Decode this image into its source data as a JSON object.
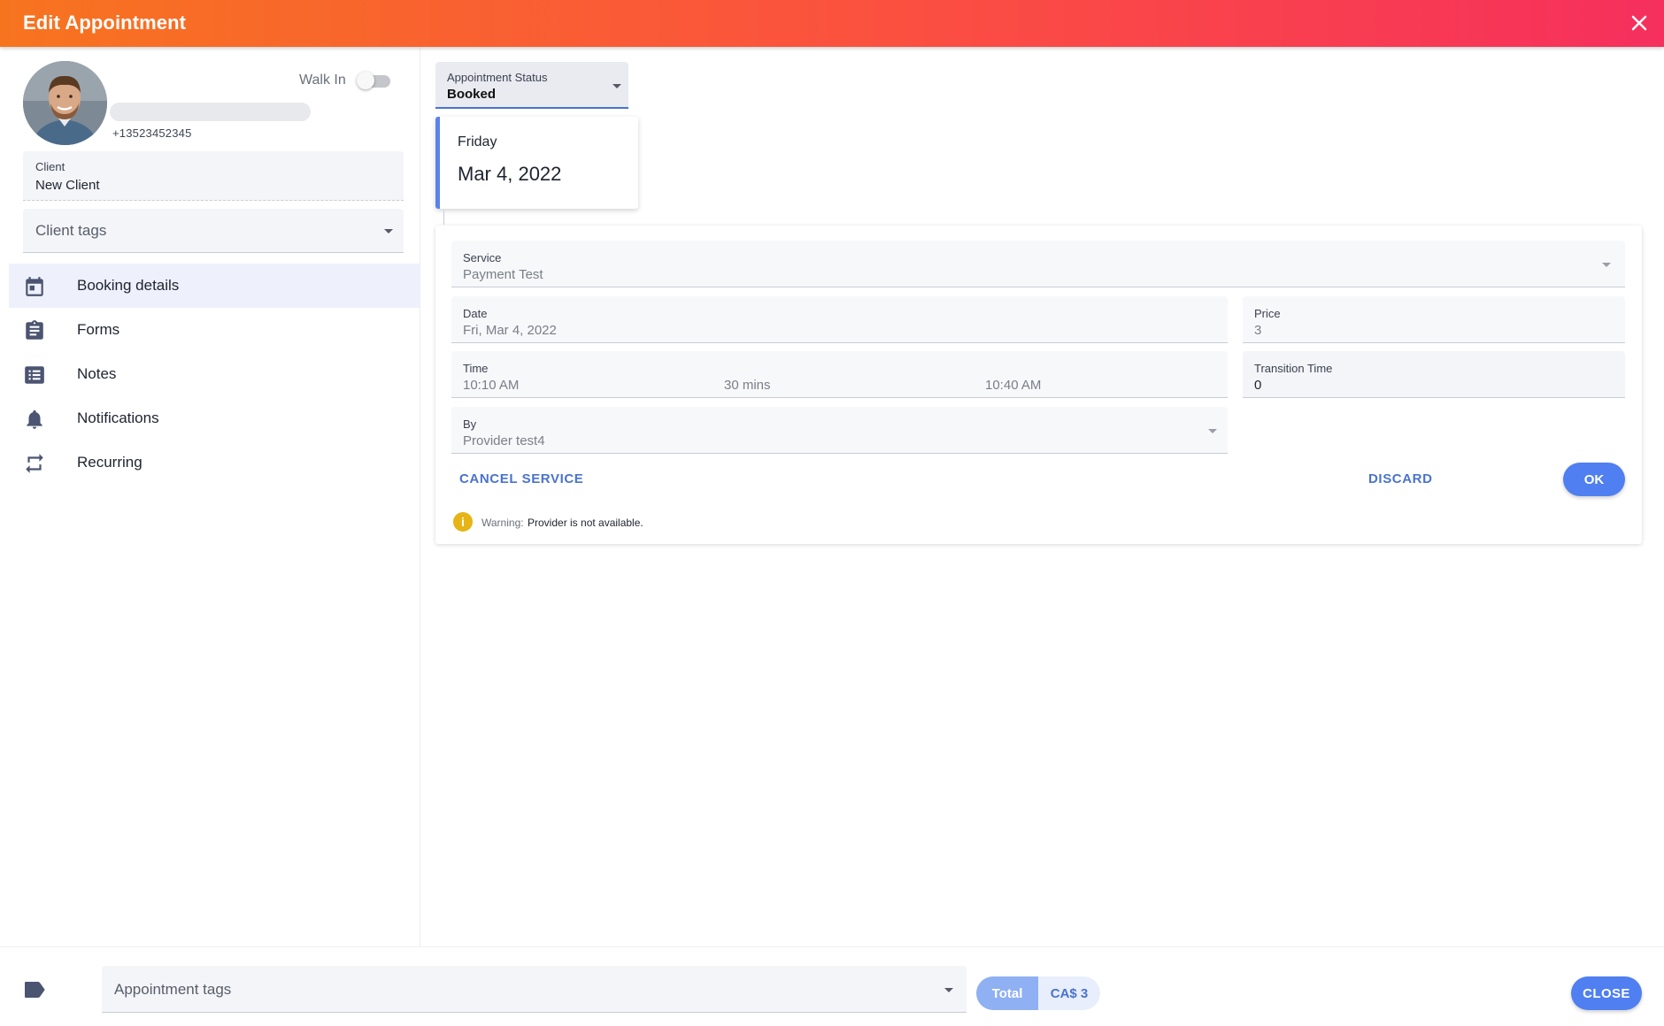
{
  "header": {
    "title": "Edit Appointment",
    "close_icon": "close-icon"
  },
  "client": {
    "phone": "+13523452345",
    "walk_in_label": "Walk In",
    "walk_in_on": false,
    "client_label": "Client",
    "client_value": "New Client",
    "tags_placeholder": "Client tags"
  },
  "nav": {
    "items": [
      {
        "label": "Booking details",
        "icon": "calendar-icon",
        "active": true
      },
      {
        "label": "Forms",
        "icon": "clipboard-icon",
        "active": false
      },
      {
        "label": "Notes",
        "icon": "notes-list-icon",
        "active": false
      },
      {
        "label": "Notifications",
        "icon": "bell-icon",
        "active": false
      },
      {
        "label": "Recurring",
        "icon": "repeat-icon",
        "active": false
      }
    ]
  },
  "status": {
    "label": "Appointment Status",
    "value": "Booked"
  },
  "date_card": {
    "day": "Friday",
    "date": "Mar 4, 2022"
  },
  "service": {
    "service_label": "Service",
    "service_value": "Payment Test",
    "date_label": "Date",
    "date_value": "Fri, Mar 4, 2022",
    "price_label": "Price",
    "price_value": "3",
    "time_label": "Time",
    "start_time": "10:10 AM",
    "duration": "30 mins",
    "end_time": "10:40 AM",
    "transition_label": "Transition Time",
    "transition_value": "0",
    "by_label": "By",
    "by_value": "Provider test4",
    "cancel_label": "CANCEL SERVICE",
    "discard_label": "DISCARD",
    "ok_label": "OK",
    "warning_label": "Warning:",
    "warning_text": "Provider is not available."
  },
  "footer": {
    "tags_placeholder": "Appointment tags",
    "total_label": "Total",
    "total_value": "CA$ 3",
    "close_label": "CLOSE"
  },
  "colors": {
    "header_start": "#f7741f",
    "header_end": "#f62f5d",
    "accent": "#4f7ff0",
    "active_nav": "#eef1fb",
    "warning": "#e7b416"
  }
}
